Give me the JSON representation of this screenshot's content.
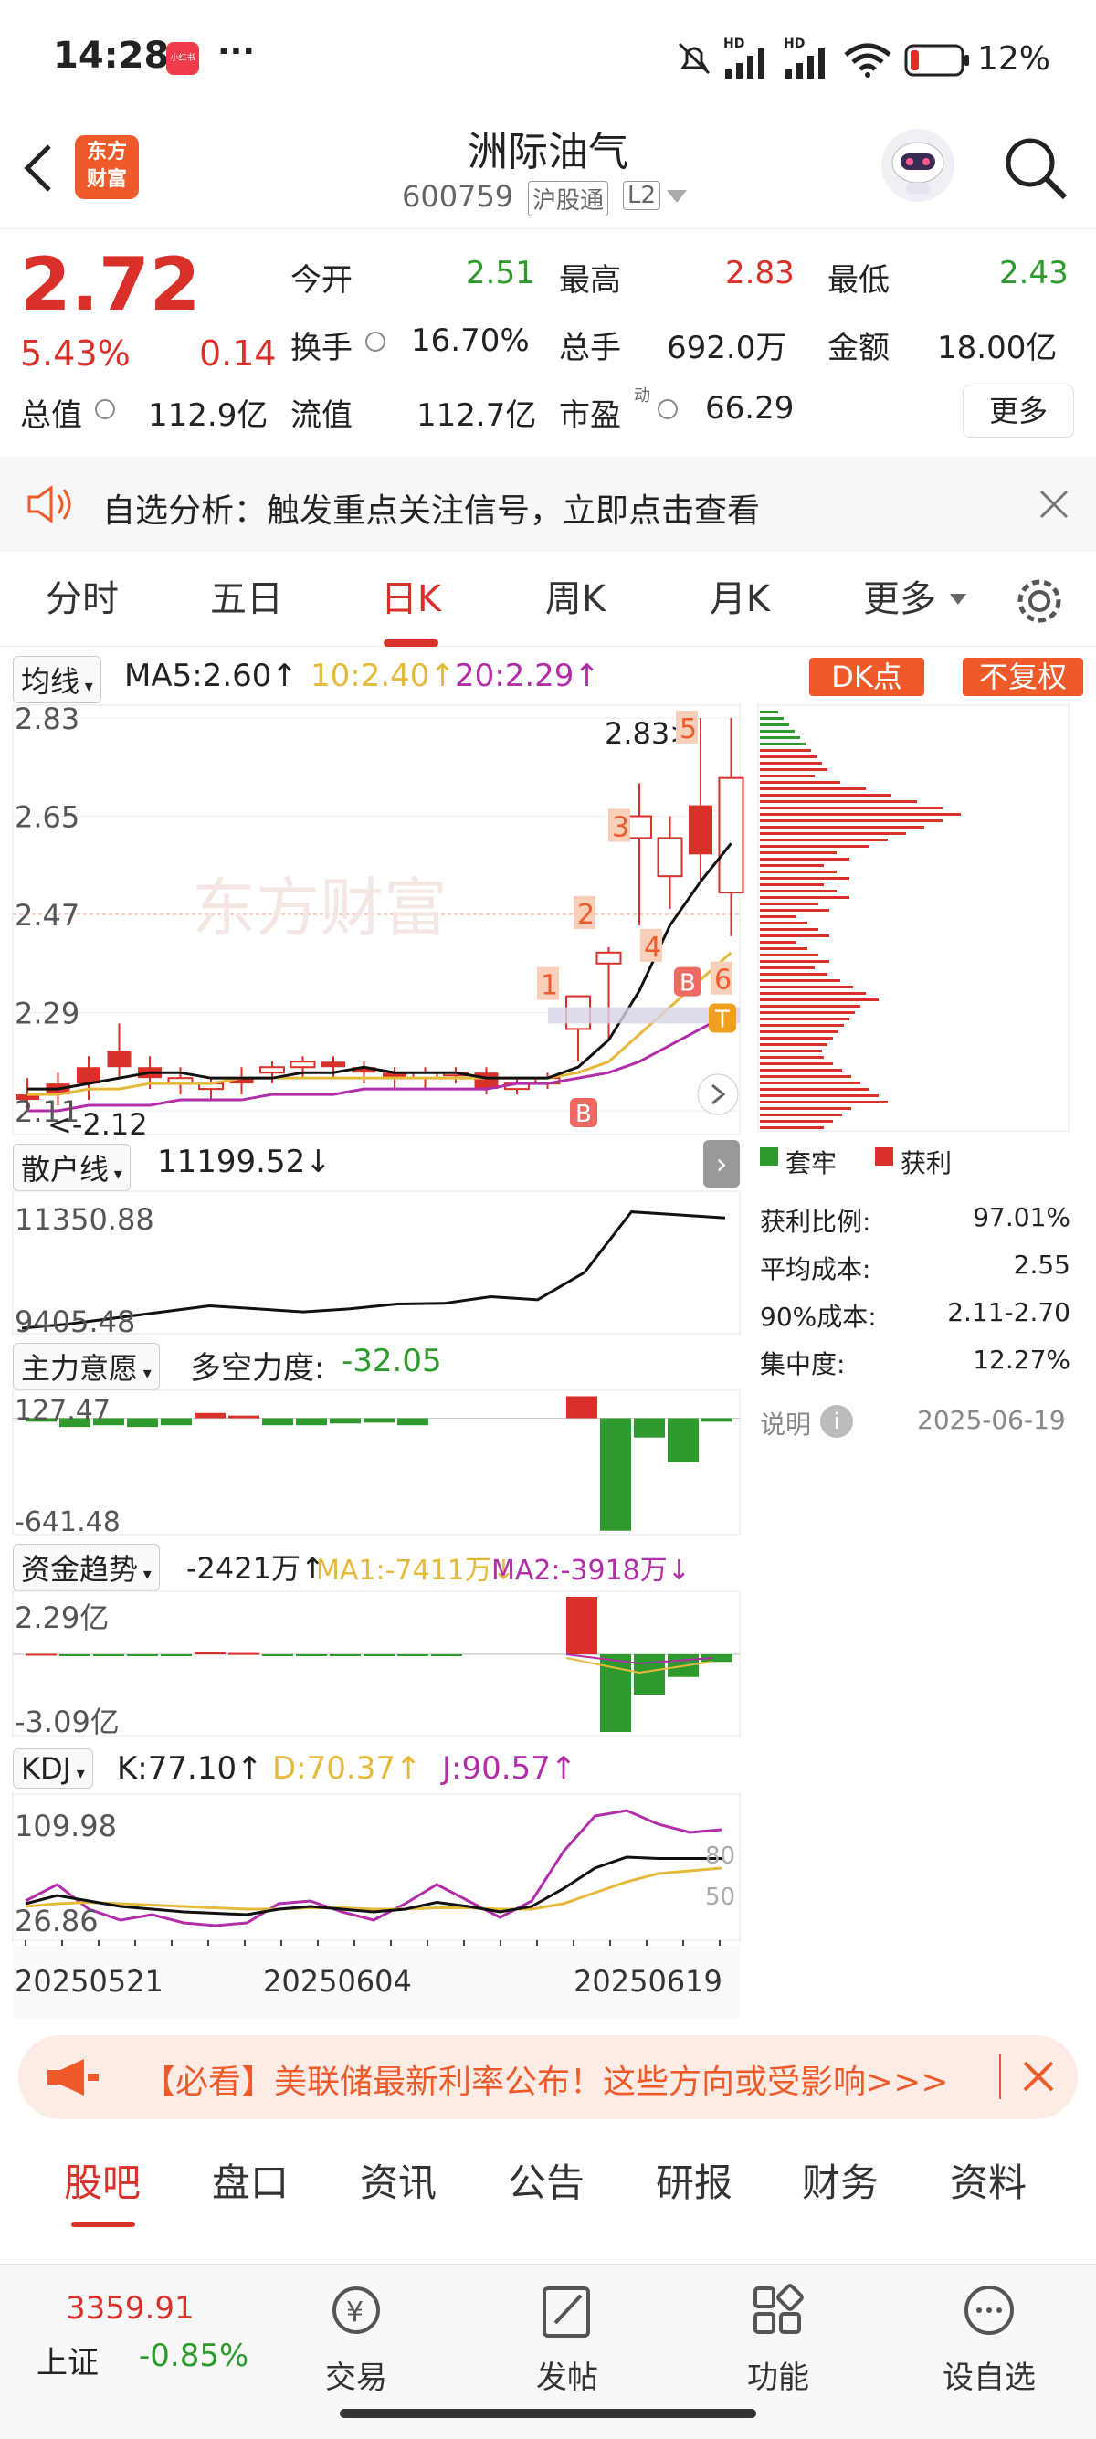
{
  "status_bar": {
    "time": "14:28",
    "app_badge": "小红书",
    "more": "···",
    "net1": "HD",
    "net2": "HD",
    "battery": "12%"
  },
  "header": {
    "back_icon": "back-arrow-icon",
    "logo_text": "东方\n财富",
    "stock_name": "洲际油气",
    "stock_code": "600759",
    "tag1": "沪股通",
    "tag2": "L2"
  },
  "quote": {
    "price": "2.72",
    "change_pct": "5.43%",
    "change": "0.14",
    "open_label": "今开",
    "open": "2.51",
    "high_label": "最高",
    "high": "2.83",
    "low_label": "最低",
    "low": "2.43",
    "turnover_label": "换手",
    "turnover": "16.70%",
    "volume_label": "总手",
    "volume": "692.0万",
    "amount_label": "金额",
    "amount": "18.00亿",
    "mktcap_label": "总值",
    "mktcap": "112.9亿",
    "float_label": "流值",
    "float": "112.7亿",
    "pe_label": "市盈",
    "pe_sup": "动",
    "pe": "66.29",
    "more_button": "更多"
  },
  "notice": {
    "text": "自选分析：触发重点关注信号，立即点击查看"
  },
  "tabs": [
    {
      "label": "分时"
    },
    {
      "label": "五日"
    },
    {
      "label": "日K"
    },
    {
      "label": "周K"
    },
    {
      "label": "月K"
    },
    {
      "label": "更多"
    }
  ],
  "kline_header": {
    "ma_selector": "均线",
    "ma5": "MA5:2.60",
    "ma10": "10:2.40",
    "ma20": "20:2.29",
    "dk_button": "DK点",
    "fq_button": "不复权"
  },
  "kline": {
    "y_labels": [
      "2.83",
      "2.65",
      "2.47",
      "2.29",
      "2.11"
    ],
    "high_marker": "2.83",
    "low_marker": "2.12",
    "watermark": "东方财富",
    "signals": [
      "1",
      "2",
      "3",
      "4",
      "5",
      "6"
    ],
    "b_badges": [
      "B",
      "B"
    ],
    "t_badge": "T",
    "candles": [
      {
        "o": 2.14,
        "c": 2.13,
        "h": 2.17,
        "l": 2.11
      },
      {
        "o": 2.16,
        "c": 2.14,
        "h": 2.18,
        "l": 2.12
      },
      {
        "o": 2.19,
        "c": 2.16,
        "h": 2.21,
        "l": 2.13
      },
      {
        "o": 2.22,
        "c": 2.19,
        "h": 2.27,
        "l": 2.17
      },
      {
        "o": 2.19,
        "c": 2.17,
        "h": 2.21,
        "l": 2.15
      },
      {
        "o": 2.16,
        "c": 2.17,
        "h": 2.19,
        "l": 2.14
      },
      {
        "o": 2.15,
        "c": 2.16,
        "h": 2.17,
        "l": 2.13
      },
      {
        "o": 2.17,
        "c": 2.16,
        "h": 2.19,
        "l": 2.14
      },
      {
        "o": 2.18,
        "c": 2.19,
        "h": 2.2,
        "l": 2.16
      },
      {
        "o": 2.19,
        "c": 2.2,
        "h": 2.21,
        "l": 2.17
      },
      {
        "o": 2.2,
        "c": 2.19,
        "h": 2.21,
        "l": 2.17
      },
      {
        "o": 2.19,
        "c": 2.18,
        "h": 2.2,
        "l": 2.16
      },
      {
        "o": 2.18,
        "c": 2.17,
        "h": 2.19,
        "l": 2.15
      },
      {
        "o": 2.17,
        "c": 2.18,
        "h": 2.19,
        "l": 2.15
      },
      {
        "o": 2.18,
        "c": 2.18,
        "h": 2.19,
        "l": 2.16
      },
      {
        "o": 2.18,
        "c": 2.15,
        "h": 2.19,
        "l": 2.14
      },
      {
        "o": 2.15,
        "c": 2.16,
        "h": 2.17,
        "l": 2.14
      },
      {
        "o": 2.16,
        "c": 2.17,
        "h": 2.18,
        "l": 2.15
      },
      {
        "o": 2.26,
        "c": 2.32,
        "h": 2.32,
        "l": 2.2
      },
      {
        "o": 2.38,
        "c": 2.4,
        "h": 2.41,
        "l": 2.24
      },
      {
        "o": 2.61,
        "c": 2.65,
        "h": 2.71,
        "l": 2.45
      },
      {
        "o": 2.54,
        "c": 2.61,
        "h": 2.65,
        "l": 2.48
      },
      {
        "o": 2.67,
        "c": 2.58,
        "h": 2.83,
        "l": 2.53
      },
      {
        "o": 2.51,
        "c": 2.72,
        "h": 2.83,
        "l": 2.43
      }
    ],
    "ma5": [
      2.15,
      2.15,
      2.16,
      2.17,
      2.18,
      2.18,
      2.17,
      2.17,
      2.17,
      2.18,
      2.18,
      2.19,
      2.18,
      2.18,
      2.18,
      2.17,
      2.17,
      2.17,
      2.19,
      2.24,
      2.33,
      2.45,
      2.53,
      2.6
    ],
    "ma10": [
      2.14,
      2.14,
      2.15,
      2.15,
      2.16,
      2.16,
      2.16,
      2.17,
      2.17,
      2.17,
      2.17,
      2.17,
      2.17,
      2.17,
      2.17,
      2.17,
      2.17,
      2.17,
      2.18,
      2.2,
      2.25,
      2.3,
      2.35,
      2.4
    ],
    "ma20": [
      2.11,
      2.11,
      2.12,
      2.12,
      2.12,
      2.13,
      2.13,
      2.13,
      2.14,
      2.14,
      2.14,
      2.15,
      2.15,
      2.15,
      2.15,
      2.15,
      2.16,
      2.16,
      2.17,
      2.18,
      2.2,
      2.23,
      2.26,
      2.29
    ]
  },
  "chip_panel": {
    "legend_trapped": "套牢",
    "legend_profit": "获利",
    "rows": [
      {
        "label": "获利比例:",
        "value": "97.01%"
      },
      {
        "label": "平均成本:",
        "value": "2.55"
      },
      {
        "label": "90%成本:",
        "value": "2.11-2.70"
      },
      {
        "label": "集中度:",
        "value": "12.27%"
      }
    ],
    "note": "说明",
    "date": "2025-06-19"
  },
  "retail_panel": {
    "selector": "散户线",
    "value": "11199.52",
    "y_top": "11350.88",
    "y_bottom": "9405.48",
    "series": [
      9380,
      9450,
      9550,
      9650,
      9750,
      9700,
      9650,
      9700,
      9780,
      9790,
      9900,
      9850,
      10300,
      11300,
      11250,
      11200
    ]
  },
  "main_panel": {
    "selector": "主力意愿",
    "label": "多空力度:",
    "value": "-32.05",
    "y_top": "127.47",
    "y_bottom": "-641.48",
    "bars": [
      -20,
      -50,
      -40,
      -50,
      -40,
      30,
      15,
      -40,
      -40,
      -30,
      -25,
      -40,
      0,
      0,
      0,
      0,
      125,
      -640,
      -110,
      -250,
      -20
    ]
  },
  "fund_panel": {
    "selector": "资金趋势",
    "value": "-2421万",
    "ma1": "MA1:-7411万",
    "ma2": "MA2:-3918万",
    "y_top": "2.29亿",
    "y_bottom": "-3.09亿",
    "bars": [
      0.02,
      -0.03,
      -0.05,
      -0.04,
      -0.03,
      0.1,
      0.05,
      -0.05,
      -0.04,
      -0.03,
      -0.04,
      -0.03,
      -0.02,
      0,
      0,
      0,
      2.29,
      -3.09,
      -1.6,
      -0.9,
      -0.3
    ]
  },
  "kdj_panel": {
    "selector": "KDJ",
    "k": "K:77.10",
    "d": "D:70.37",
    "j": "J:90.57",
    "y_top": "109.98",
    "y_bottom": "26.86",
    "ref80": "80",
    "ref50": "50",
    "x_labels": [
      "20250521",
      "20250604",
      "20250619"
    ],
    "k_series": [
      44,
      50,
      46,
      42,
      40,
      38,
      37,
      36,
      40,
      42,
      40,
      38,
      40,
      45,
      42,
      38,
      42,
      55,
      70,
      78,
      77,
      77,
      77
    ],
    "d_series": [
      42,
      44,
      45,
      44,
      43,
      42,
      41,
      40,
      40,
      41,
      41,
      40,
      40,
      41,
      41,
      40,
      40,
      44,
      52,
      60,
      66,
      68,
      70
    ],
    "j_series": [
      46,
      58,
      40,
      32,
      36,
      30,
      28,
      30,
      44,
      46,
      38,
      32,
      44,
      58,
      46,
      34,
      46,
      82,
      108,
      112,
      102,
      96,
      98
    ]
  },
  "banner": {
    "text": "【必看】美联储最新利率公布！这些方向或受影响>>>"
  },
  "sub_tabs": [
    {
      "label": "股吧"
    },
    {
      "label": "盘口"
    },
    {
      "label": "资讯"
    },
    {
      "label": "公告"
    },
    {
      "label": "研报"
    },
    {
      "label": "财务"
    },
    {
      "label": "资料"
    }
  ],
  "bottom_nav": {
    "index_value": "3359.91",
    "index_name": "上证",
    "index_change": "-0.85%",
    "items": [
      {
        "label": "交易",
        "icon": "yuan-trade-icon"
      },
      {
        "label": "发帖",
        "icon": "edit-post-icon"
      },
      {
        "label": "功能",
        "icon": "grid-function-icon"
      },
      {
        "label": "设自选",
        "icon": "add-watchlist-icon"
      }
    ]
  },
  "colors": {
    "up": "#d9302a",
    "down": "#2e9a2e",
    "ma10": "#e5b93a",
    "ma20": "#b12ea8",
    "accent": "#ef5a2b"
  }
}
